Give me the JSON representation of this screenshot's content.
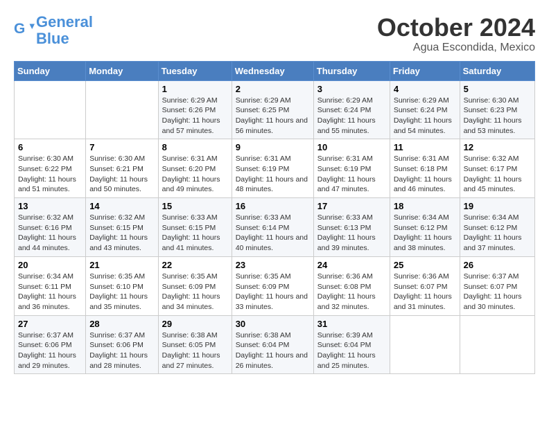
{
  "logo": {
    "line1": "General",
    "line2": "Blue"
  },
  "title": "October 2024",
  "subtitle": "Agua Escondida, Mexico",
  "days_of_week": [
    "Sunday",
    "Monday",
    "Tuesday",
    "Wednesday",
    "Thursday",
    "Friday",
    "Saturday"
  ],
  "weeks": [
    [
      {
        "day": "",
        "content": ""
      },
      {
        "day": "",
        "content": ""
      },
      {
        "day": "1",
        "content": "Sunrise: 6:29 AM\nSunset: 6:26 PM\nDaylight: 11 hours and 57 minutes."
      },
      {
        "day": "2",
        "content": "Sunrise: 6:29 AM\nSunset: 6:25 PM\nDaylight: 11 hours and 56 minutes."
      },
      {
        "day": "3",
        "content": "Sunrise: 6:29 AM\nSunset: 6:24 PM\nDaylight: 11 hours and 55 minutes."
      },
      {
        "day": "4",
        "content": "Sunrise: 6:29 AM\nSunset: 6:24 PM\nDaylight: 11 hours and 54 minutes."
      },
      {
        "day": "5",
        "content": "Sunrise: 6:30 AM\nSunset: 6:23 PM\nDaylight: 11 hours and 53 minutes."
      }
    ],
    [
      {
        "day": "6",
        "content": "Sunrise: 6:30 AM\nSunset: 6:22 PM\nDaylight: 11 hours and 51 minutes."
      },
      {
        "day": "7",
        "content": "Sunrise: 6:30 AM\nSunset: 6:21 PM\nDaylight: 11 hours and 50 minutes."
      },
      {
        "day": "8",
        "content": "Sunrise: 6:31 AM\nSunset: 6:20 PM\nDaylight: 11 hours and 49 minutes."
      },
      {
        "day": "9",
        "content": "Sunrise: 6:31 AM\nSunset: 6:19 PM\nDaylight: 11 hours and 48 minutes."
      },
      {
        "day": "10",
        "content": "Sunrise: 6:31 AM\nSunset: 6:19 PM\nDaylight: 11 hours and 47 minutes."
      },
      {
        "day": "11",
        "content": "Sunrise: 6:31 AM\nSunset: 6:18 PM\nDaylight: 11 hours and 46 minutes."
      },
      {
        "day": "12",
        "content": "Sunrise: 6:32 AM\nSunset: 6:17 PM\nDaylight: 11 hours and 45 minutes."
      }
    ],
    [
      {
        "day": "13",
        "content": "Sunrise: 6:32 AM\nSunset: 6:16 PM\nDaylight: 11 hours and 44 minutes."
      },
      {
        "day": "14",
        "content": "Sunrise: 6:32 AM\nSunset: 6:15 PM\nDaylight: 11 hours and 43 minutes."
      },
      {
        "day": "15",
        "content": "Sunrise: 6:33 AM\nSunset: 6:15 PM\nDaylight: 11 hours and 41 minutes."
      },
      {
        "day": "16",
        "content": "Sunrise: 6:33 AM\nSunset: 6:14 PM\nDaylight: 11 hours and 40 minutes."
      },
      {
        "day": "17",
        "content": "Sunrise: 6:33 AM\nSunset: 6:13 PM\nDaylight: 11 hours and 39 minutes."
      },
      {
        "day": "18",
        "content": "Sunrise: 6:34 AM\nSunset: 6:12 PM\nDaylight: 11 hours and 38 minutes."
      },
      {
        "day": "19",
        "content": "Sunrise: 6:34 AM\nSunset: 6:12 PM\nDaylight: 11 hours and 37 minutes."
      }
    ],
    [
      {
        "day": "20",
        "content": "Sunrise: 6:34 AM\nSunset: 6:11 PM\nDaylight: 11 hours and 36 minutes."
      },
      {
        "day": "21",
        "content": "Sunrise: 6:35 AM\nSunset: 6:10 PM\nDaylight: 11 hours and 35 minutes."
      },
      {
        "day": "22",
        "content": "Sunrise: 6:35 AM\nSunset: 6:09 PM\nDaylight: 11 hours and 34 minutes."
      },
      {
        "day": "23",
        "content": "Sunrise: 6:35 AM\nSunset: 6:09 PM\nDaylight: 11 hours and 33 minutes."
      },
      {
        "day": "24",
        "content": "Sunrise: 6:36 AM\nSunset: 6:08 PM\nDaylight: 11 hours and 32 minutes."
      },
      {
        "day": "25",
        "content": "Sunrise: 6:36 AM\nSunset: 6:07 PM\nDaylight: 11 hours and 31 minutes."
      },
      {
        "day": "26",
        "content": "Sunrise: 6:37 AM\nSunset: 6:07 PM\nDaylight: 11 hours and 30 minutes."
      }
    ],
    [
      {
        "day": "27",
        "content": "Sunrise: 6:37 AM\nSunset: 6:06 PM\nDaylight: 11 hours and 29 minutes."
      },
      {
        "day": "28",
        "content": "Sunrise: 6:37 AM\nSunset: 6:06 PM\nDaylight: 11 hours and 28 minutes."
      },
      {
        "day": "29",
        "content": "Sunrise: 6:38 AM\nSunset: 6:05 PM\nDaylight: 11 hours and 27 minutes."
      },
      {
        "day": "30",
        "content": "Sunrise: 6:38 AM\nSunset: 6:04 PM\nDaylight: 11 hours and 26 minutes."
      },
      {
        "day": "31",
        "content": "Sunrise: 6:39 AM\nSunset: 6:04 PM\nDaylight: 11 hours and 25 minutes."
      },
      {
        "day": "",
        "content": ""
      },
      {
        "day": "",
        "content": ""
      }
    ]
  ]
}
